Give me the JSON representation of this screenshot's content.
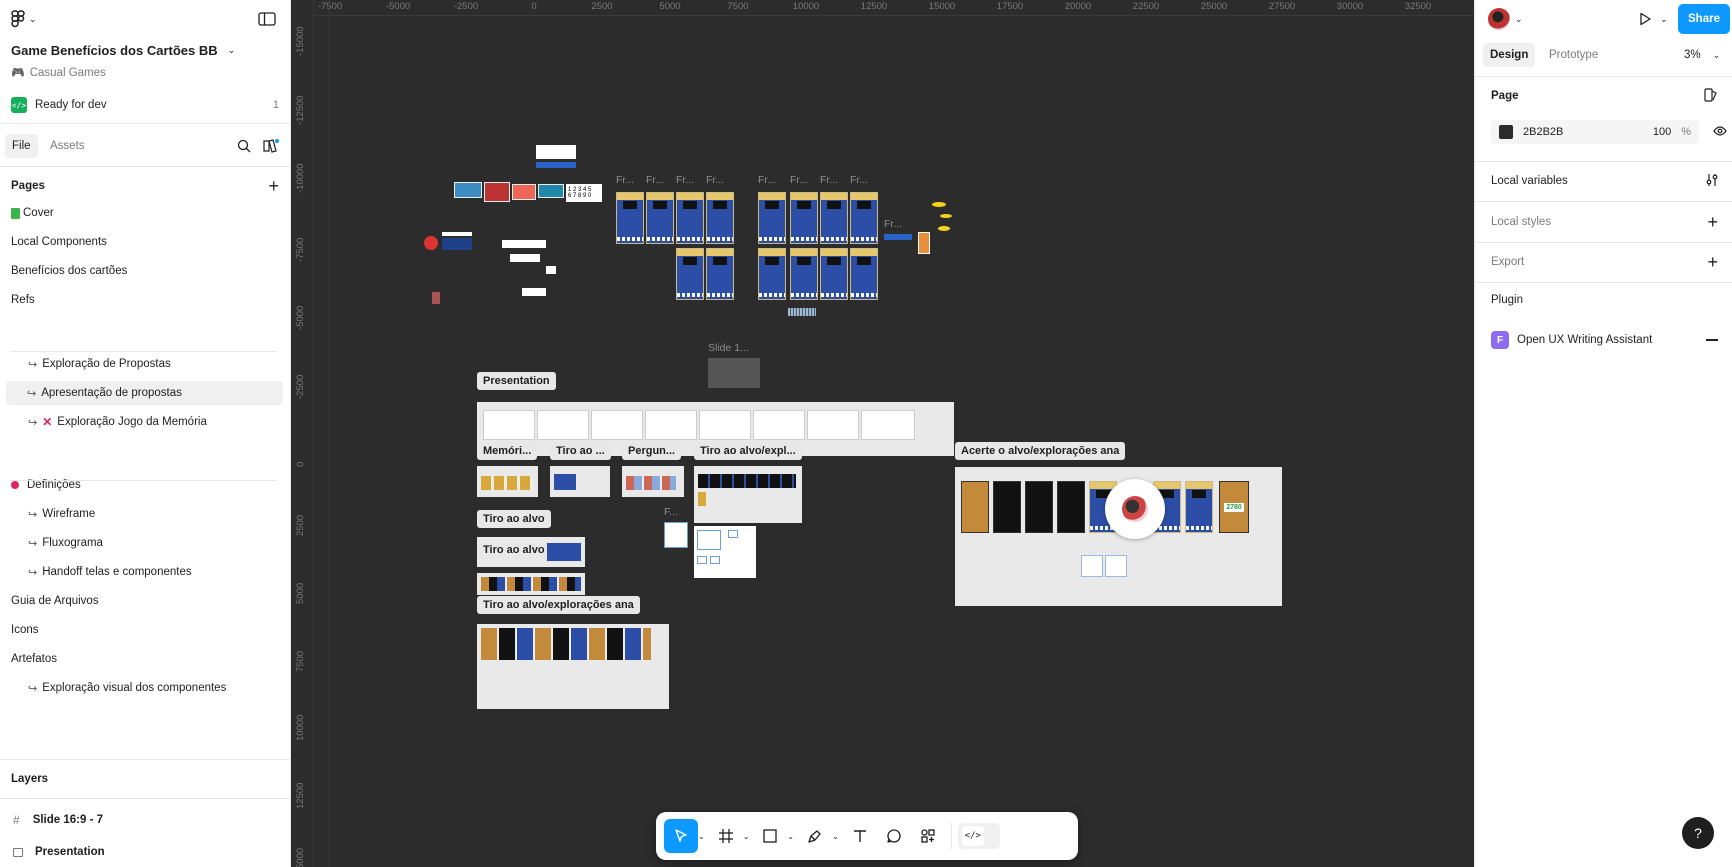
{
  "file": {
    "name": "Game Benefícios dos Cartões BB",
    "project": "Casual Games",
    "status": "Ready for dev",
    "status_count": "1"
  },
  "tabs": {
    "file": "File",
    "assets": "Assets"
  },
  "pages": {
    "header": "Pages",
    "items": [
      {
        "label": "Cover",
        "kind": "top",
        "icon": "green-square"
      },
      {
        "label": "Local Components",
        "kind": "top"
      },
      {
        "label": "Benefícios dos cartões",
        "kind": "top"
      },
      {
        "label": "Refs",
        "kind": "top"
      },
      {
        "label": "Exploração de Propostas",
        "kind": "sub"
      },
      {
        "label": "Apresentação de propostas",
        "kind": "sub",
        "active": true
      },
      {
        "label": "Exploração Jogo da Memória",
        "kind": "sub",
        "icon": "red-x"
      },
      {
        "label": "Definições",
        "kind": "top",
        "icon": "pushpin"
      },
      {
        "label": "Wireframe",
        "kind": "sub"
      },
      {
        "label": "Fluxograma",
        "kind": "sub"
      },
      {
        "label": "Handoff telas e componentes",
        "kind": "sub"
      },
      {
        "label": "Guia de Arquivos",
        "kind": "top"
      },
      {
        "label": "Icons",
        "kind": "top"
      },
      {
        "label": "Artefatos",
        "kind": "top"
      },
      {
        "label": "Exploração visual dos componentes",
        "kind": "sub"
      }
    ]
  },
  "layers": {
    "header": "Layers",
    "items": [
      {
        "label": "Slide 16:9 - 7",
        "icon": "frame-icon"
      },
      {
        "label": "Presentation",
        "icon": "section-icon"
      }
    ]
  },
  "ruler": {
    "x": [
      "-7500",
      "-5000",
      "-2500",
      "0",
      "2500",
      "5000",
      "7500",
      "10000",
      "12500",
      "15000",
      "17500",
      "20000",
      "22500",
      "25000",
      "27500",
      "30000",
      "32500"
    ],
    "y": [
      "-15000",
      "-12500",
      "-10000",
      "-7500",
      "-5000",
      "-2500",
      "0",
      "2500",
      "5000",
      "7500",
      "10000",
      "12500",
      "5000"
    ]
  },
  "canvas": {
    "section_labels": {
      "presentation": "Presentation",
      "memoria": "Memóri...",
      "tiro1": "Tiro ao ...",
      "pergun": "Pergun...",
      "tiro_explor": "Tiro ao alvo/expl...",
      "acerte": "Acerte o alvo/explorações ana",
      "tiro_alvo1": "Tiro ao alvo",
      "tiro_alvo2": "Tiro ao alvo",
      "tiro_explor_ana": "Tiro ao alvo/explorações ana"
    },
    "frame_labels": {
      "slide": "Slide 1...",
      "f": "F...",
      "fr1": "Fr...",
      "fr2": "Fr...",
      "fr3": "Fr...",
      "fr4": "Fr...",
      "fr5": "Fr...",
      "fr6": "Fr...",
      "fr7": "Fr...",
      "fr8": "Fr...",
      "fr9": "Fr..."
    },
    "numbers_row1": "1 2 3 4 5",
    "numbers_row2": "6 7 8 9 0",
    "score": "2780"
  },
  "right": {
    "tabs": {
      "design": "Design",
      "prototype": "Prototype"
    },
    "zoom": "3%",
    "share": "Share",
    "page_header": "Page",
    "bg_color_hex": "2B2B2B",
    "bg_opacity": "100",
    "percent": "%",
    "local_variables": "Local variables",
    "local_styles": "Local styles",
    "export": "Export",
    "plugin": "Plugin",
    "plugin_name": "Open UX Writing Assistant",
    "plugin_initial": "F"
  },
  "help": "?",
  "colors": {
    "accent": "#0d99ff",
    "canvas": "#2c2c2c",
    "plugin": "#8e6cf1",
    "status": "#14ae5c"
  }
}
